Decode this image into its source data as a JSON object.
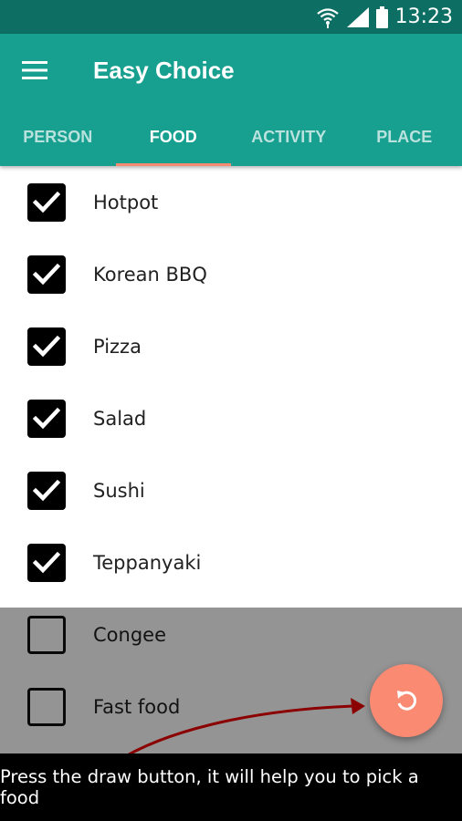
{
  "status_bar": {
    "time": "13:23"
  },
  "app_bar": {
    "title": "Easy Choice"
  },
  "tabs": [
    {
      "label": "PERSON",
      "active": false
    },
    {
      "label": "FOOD",
      "active": true
    },
    {
      "label": "ACTIVITY",
      "active": false
    },
    {
      "label": "PLACE",
      "active": false
    }
  ],
  "foods": [
    {
      "label": "Hotpot",
      "checked": true
    },
    {
      "label": "Korean BBQ",
      "checked": true
    },
    {
      "label": "Pizza",
      "checked": true
    },
    {
      "label": "Salad",
      "checked": true
    },
    {
      "label": "Sushi",
      "checked": true
    },
    {
      "label": "Teppanyaki",
      "checked": true
    },
    {
      "label": "Congee",
      "checked": false
    },
    {
      "label": "Fast food",
      "checked": false
    }
  ],
  "tooltip": {
    "text": "Press the draw button, it will help you to pick a food"
  },
  "colors": {
    "status_bar": "#0d6f64",
    "app_bar": "#179f8f",
    "accent": "#fb8a73",
    "arrow": "#8b0000"
  }
}
